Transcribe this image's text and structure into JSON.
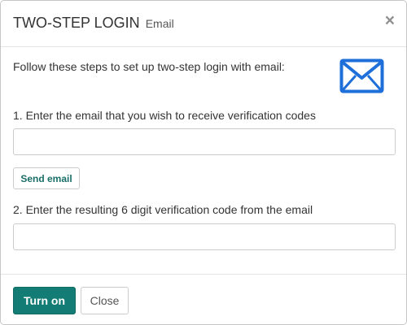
{
  "dialog": {
    "title": "TWO-STEP LOGIN",
    "subtitle": "Email",
    "close_glyph": "×"
  },
  "intro": {
    "text": "Follow these steps to set up two-step login with email:",
    "icon": "envelope-icon",
    "icon_color": "#1e6fd9"
  },
  "step1": {
    "label": "1. Enter the email that you wish to receive verification codes",
    "email_value": "",
    "send_label": "Send email"
  },
  "step2": {
    "label": "2. Enter the resulting 6 digit verification code from the email",
    "code_value": ""
  },
  "footer": {
    "primary_label": "Turn on",
    "close_label": "Close"
  },
  "colors": {
    "primary": "#137c74",
    "link_text": "#1b6f69"
  }
}
